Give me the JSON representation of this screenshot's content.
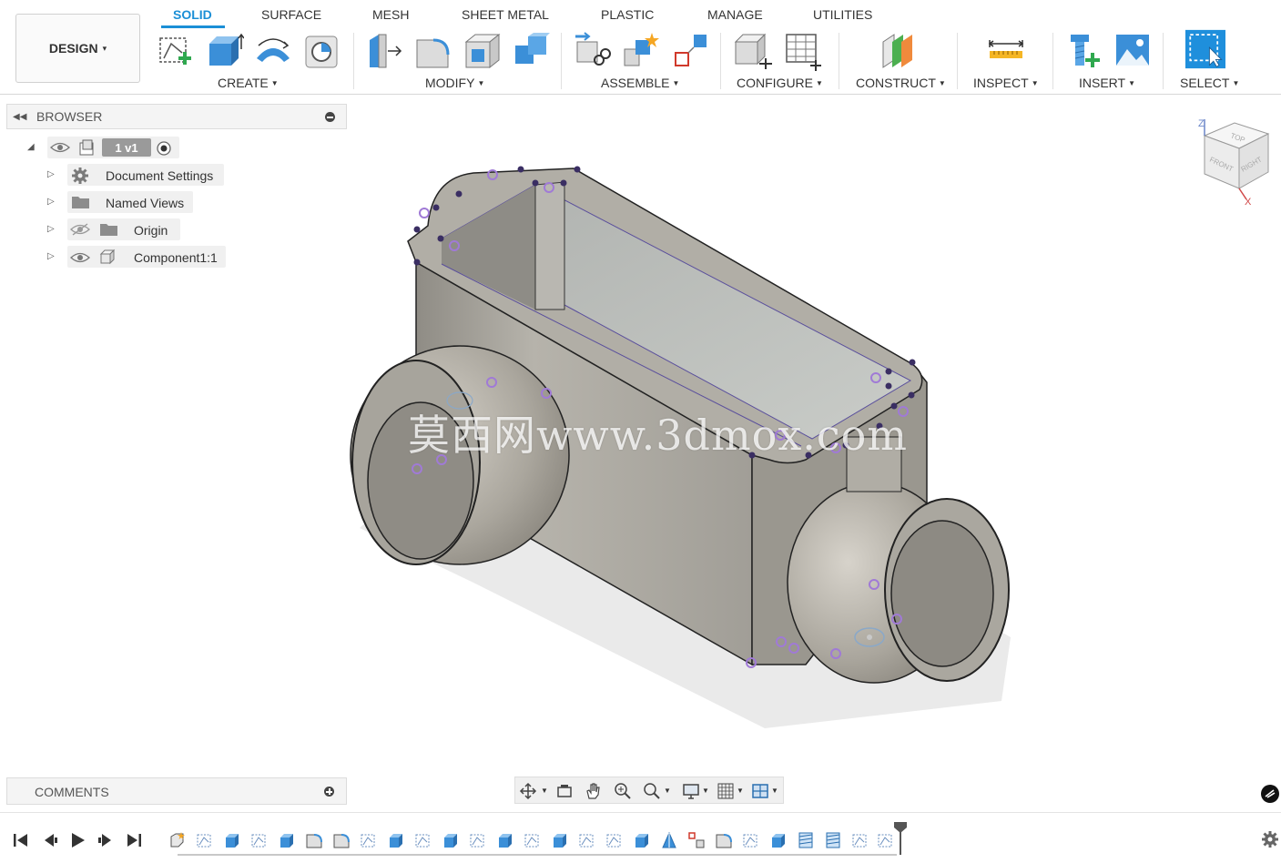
{
  "workspace": {
    "label": "DESIGN",
    "caret": "▾"
  },
  "tabs": [
    {
      "label": "SOLID",
      "active": true
    },
    {
      "label": "SURFACE"
    },
    {
      "label": "MESH"
    },
    {
      "label": "SHEET METAL"
    },
    {
      "label": "PLASTIC"
    },
    {
      "label": "MANAGE"
    },
    {
      "label": "UTILITIES"
    }
  ],
  "groups": {
    "create": "CREATE",
    "modify": "MODIFY",
    "assemble": "ASSEMBLE",
    "configure": "CONFIGURE",
    "construct": "CONSTRUCT",
    "inspect": "INSPECT",
    "insert": "INSERT",
    "select": "SELECT"
  },
  "browser": {
    "title": "BROWSER",
    "root": "1 v1",
    "items": [
      {
        "label": "Document Settings",
        "icon": "gear-icon"
      },
      {
        "label": "Named Views",
        "icon": "folder-icon"
      },
      {
        "label": "Origin",
        "icon": "folder-icon",
        "hidden": true
      },
      {
        "label": "Component1:1",
        "icon": "component-icon"
      }
    ]
  },
  "comments": {
    "label": "COMMENTS"
  },
  "viewcube": {
    "top": "TOP",
    "front": "FRONT",
    "right": "RIGHT",
    "z": "Z",
    "x": "X"
  },
  "watermark": "莫西网www.3dmox.com",
  "colors": {
    "accent": "#1b8fd6",
    "toolbar_bg": "#ffffff",
    "model_gray": "#a9a69e",
    "select_blue": "#1f8fdc"
  }
}
